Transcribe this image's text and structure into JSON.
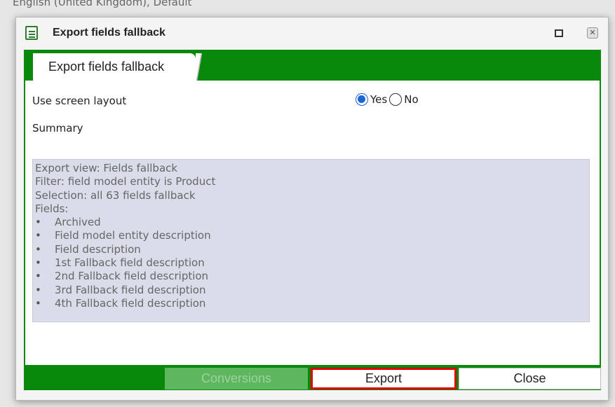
{
  "background": {
    "top_text": "English (United Kingdom), Default"
  },
  "dialog": {
    "title": "Export fields fallback",
    "icon": "form-icon",
    "maximize_icon": "maximize-icon",
    "close_icon": "close-icon",
    "close_glyph": "✕",
    "tab_label": "Export fields fallback"
  },
  "form": {
    "use_screen_layout_label": "Use screen layout",
    "yes_label": "Yes",
    "no_label": "No",
    "selected": "Yes",
    "summary_label": "Summary",
    "summary_lines": [
      "Export view: Fields fallback",
      "Filter: field model entity is Product",
      "Selection: all 63 fields fallback",
      "Fields:"
    ],
    "summary_fields": [
      "Archived",
      "Field model entity description",
      "Field description",
      "1st Fallback field description",
      "2nd Fallback field description",
      "3rd Fallback field description",
      "4th Fallback field description"
    ]
  },
  "buttons": {
    "conversions": "Conversions",
    "export": "Export",
    "close": "Close"
  },
  "colors": {
    "accent_green": "#08890b",
    "highlight_red": "#e00000",
    "radio_blue": "#1a66d6"
  }
}
